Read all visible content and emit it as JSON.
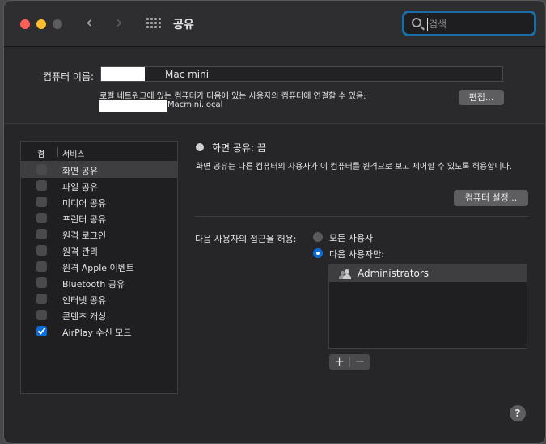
{
  "window": {
    "title": "공유"
  },
  "search": {
    "placeholder": "검색",
    "value": ""
  },
  "computer": {
    "name_label": "컴퓨터 이름:",
    "name_value": "Mac mini",
    "local_description": "로컬 네트워크에 있는 컴퓨터가 다음에 있는 사용자의 컴퓨터에 연결할 수 있음:",
    "local_hostname": "Macmini.local",
    "edit_button": "편집..."
  },
  "services": {
    "header_on": "켬",
    "header_service": "서비스",
    "items": [
      {
        "label": "화면 공유",
        "checked": false,
        "selected": true
      },
      {
        "label": "파일 공유",
        "checked": false,
        "selected": false
      },
      {
        "label": "미디어 공유",
        "checked": false,
        "selected": false
      },
      {
        "label": "프린터 공유",
        "checked": false,
        "selected": false
      },
      {
        "label": "원격 로그인",
        "checked": false,
        "selected": false
      },
      {
        "label": "원격 관리",
        "checked": false,
        "selected": false
      },
      {
        "label": "원격 Apple 이벤트",
        "checked": false,
        "selected": false
      },
      {
        "label": "Bluetooth 공유",
        "checked": false,
        "selected": false
      },
      {
        "label": "인터넷 공유",
        "checked": false,
        "selected": false
      },
      {
        "label": "콘텐츠 캐싱",
        "checked": false,
        "selected": false
      },
      {
        "label": "AirPlay 수신 모드",
        "checked": true,
        "selected": false
      }
    ]
  },
  "detail": {
    "status": "화면 공유: 끔",
    "description": "화면 공유는 다른 컴퓨터의 사용자가 이 컴퓨터를 원격으로 보고 제어할 수 있도록 허용합니다.",
    "settings_button": "컴퓨터 설정...",
    "access_label": "다음 사용자의 접근을 허용:",
    "option_all": "모든 사용자",
    "option_only": "다음 사용자만:",
    "selected_option": "only",
    "users": [
      "Administrators"
    ],
    "add_label": "+",
    "remove_label": "−"
  },
  "help": {
    "label": "?"
  },
  "colors": {
    "accent": "#0a6cd8",
    "search_focus": "#1a6ea8",
    "close": "#ff5f57",
    "minimize": "#febc2e"
  }
}
